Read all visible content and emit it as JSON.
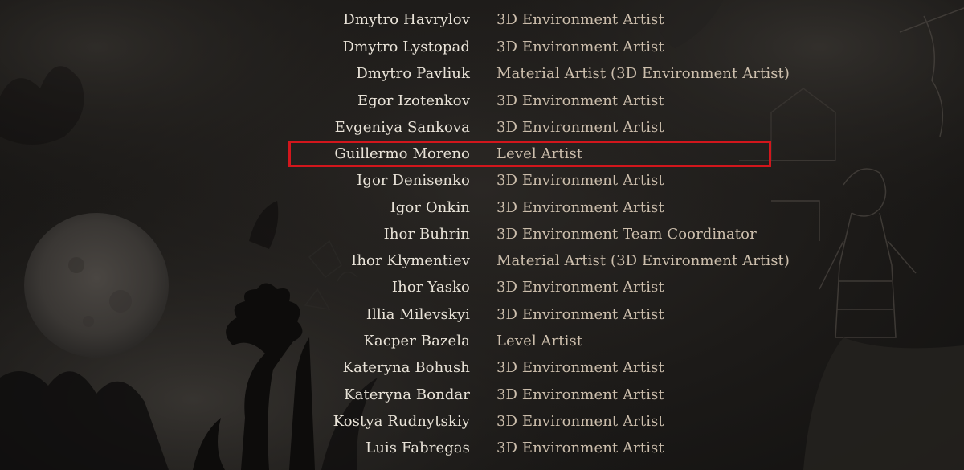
{
  "credits": {
    "rows": [
      {
        "name": "",
        "role": ""
      },
      {
        "name": "Dmytro Havrylov",
        "role": "3D Environment Artist"
      },
      {
        "name": "Dmytro Lystopad",
        "role": "3D Environment Artist"
      },
      {
        "name": "Dmytro Pavliuk",
        "role": "Material Artist (3D Environment Artist)"
      },
      {
        "name": "Egor Izotenkov",
        "role": "3D Environment Artist"
      },
      {
        "name": "Evgeniya Sankova",
        "role": "3D Environment Artist"
      },
      {
        "name": "Guillermo Moreno",
        "role": "Level Artist"
      },
      {
        "name": "Igor Denisenko",
        "role": "3D Environment Artist"
      },
      {
        "name": "Igor Onkin",
        "role": "3D Environment Artist"
      },
      {
        "name": "Ihor Buhrin",
        "role": "3D Environment Team Coordinator"
      },
      {
        "name": "Ihor Klymentiev",
        "role": "Material Artist (3D Environment Artist)"
      },
      {
        "name": "Ihor Yasko",
        "role": "3D Environment Artist"
      },
      {
        "name": "Illia Milevskyi",
        "role": "3D Environment Artist"
      },
      {
        "name": "Kacper Bazela",
        "role": "Level Artist"
      },
      {
        "name": "Kateryna Bohush",
        "role": "3D Environment Artist"
      },
      {
        "name": "Kateryna Bondar",
        "role": "3D Environment Artist"
      },
      {
        "name": "Kostya Rudnytskiy",
        "role": "3D Environment Artist"
      },
      {
        "name": "Luis Fabregas",
        "role": "3D Environment Artist"
      },
      {
        "name": "",
        "role": ""
      }
    ]
  },
  "highlight": {
    "color": "#d2161c"
  },
  "colors": {
    "name_text": "#e9e3d8",
    "role_text": "#cdbfad",
    "background": "#1c1a18"
  },
  "icons": [
    "moon-illustration",
    "dandelion-illustration",
    "folk-figure-illustration"
  ]
}
